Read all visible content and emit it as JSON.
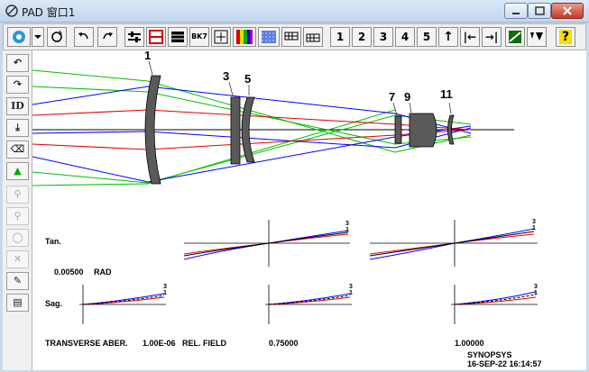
{
  "window": {
    "title": "PAD 窗口1"
  },
  "toolbar": {
    "buttons": [
      {
        "name": "gear-button",
        "label": ""
      },
      {
        "name": "dropdown-button",
        "label": ""
      },
      {
        "name": "sync-button",
        "label": ""
      },
      {
        "name": "undo-button",
        "label": ""
      },
      {
        "name": "redo-button",
        "label": ""
      },
      {
        "name": "adjust-button",
        "label": ""
      },
      {
        "name": "split-button",
        "label": ""
      },
      {
        "name": "table-button",
        "label": ""
      },
      {
        "name": "bk7-button",
        "label": "BK7"
      },
      {
        "name": "fit-button",
        "label": ""
      },
      {
        "name": "color-button",
        "label": ""
      },
      {
        "name": "pattern-button",
        "label": ""
      },
      {
        "name": "grid1-button",
        "label": ""
      },
      {
        "name": "grid2-button",
        "label": ""
      },
      {
        "name": "page-1-button",
        "label": "1"
      },
      {
        "name": "page-2-button",
        "label": "2"
      },
      {
        "name": "page-3-button",
        "label": "3"
      },
      {
        "name": "page-4-button",
        "label": "4"
      },
      {
        "name": "page-5-button",
        "label": "5"
      },
      {
        "name": "up-button",
        "label": "↑"
      },
      {
        "name": "first-button",
        "label": "|←"
      },
      {
        "name": "last-button",
        "label": "→|"
      },
      {
        "name": "chart-button",
        "label": ""
      },
      {
        "name": "vtri-button",
        "label": ""
      },
      {
        "name": "help-button",
        "label": "?"
      }
    ]
  },
  "sidebar": {
    "items": [
      {
        "name": "undo-side-button",
        "label": "↶",
        "disabled": false
      },
      {
        "name": "redo-side-button",
        "label": "↷",
        "disabled": false
      },
      {
        "name": "id-button",
        "label": "ID",
        "disabled": false
      },
      {
        "name": "download-button",
        "label": "⤓",
        "disabled": false
      },
      {
        "name": "eraser-button",
        "label": "⌫",
        "disabled": false
      },
      {
        "name": "target-button",
        "label": "▲",
        "disabled": false
      },
      {
        "name": "tool7-button",
        "label": "⚲",
        "disabled": true
      },
      {
        "name": "tool8-button",
        "label": "⚲",
        "disabled": true
      },
      {
        "name": "tool9-button",
        "label": "◯",
        "disabled": true
      },
      {
        "name": "tool10-button",
        "label": "✕",
        "disabled": true
      },
      {
        "name": "pen-button",
        "label": "✎",
        "disabled": false
      },
      {
        "name": "notes-button",
        "label": "▤",
        "disabled": false
      }
    ]
  },
  "lens": {
    "surface_labels": [
      "1",
      "3",
      "5",
      "7",
      "9",
      "11"
    ]
  },
  "aberrations": {
    "tan_label": "Tan.",
    "sag_label": "Sag.",
    "scale": "0.00500",
    "scale_unit": "RAD",
    "footer_title": "TRANSVERSE ABER.",
    "wavelength": "1.00E-06",
    "field_label": "REL. FIELD",
    "field_mid": "0.75000",
    "field_full": "1.00000",
    "curve_tag_top": "3",
    "curve_tag_bottom": "1"
  },
  "stamp": {
    "program": "SYNOPSYS",
    "datetime": "16-SEP-22  16:14:57"
  },
  "colors": {
    "ray_green": "#00c000",
    "ray_blue": "#0000ff",
    "ray_red": "#e00000",
    "lens_fill": "#5a5a5a"
  }
}
